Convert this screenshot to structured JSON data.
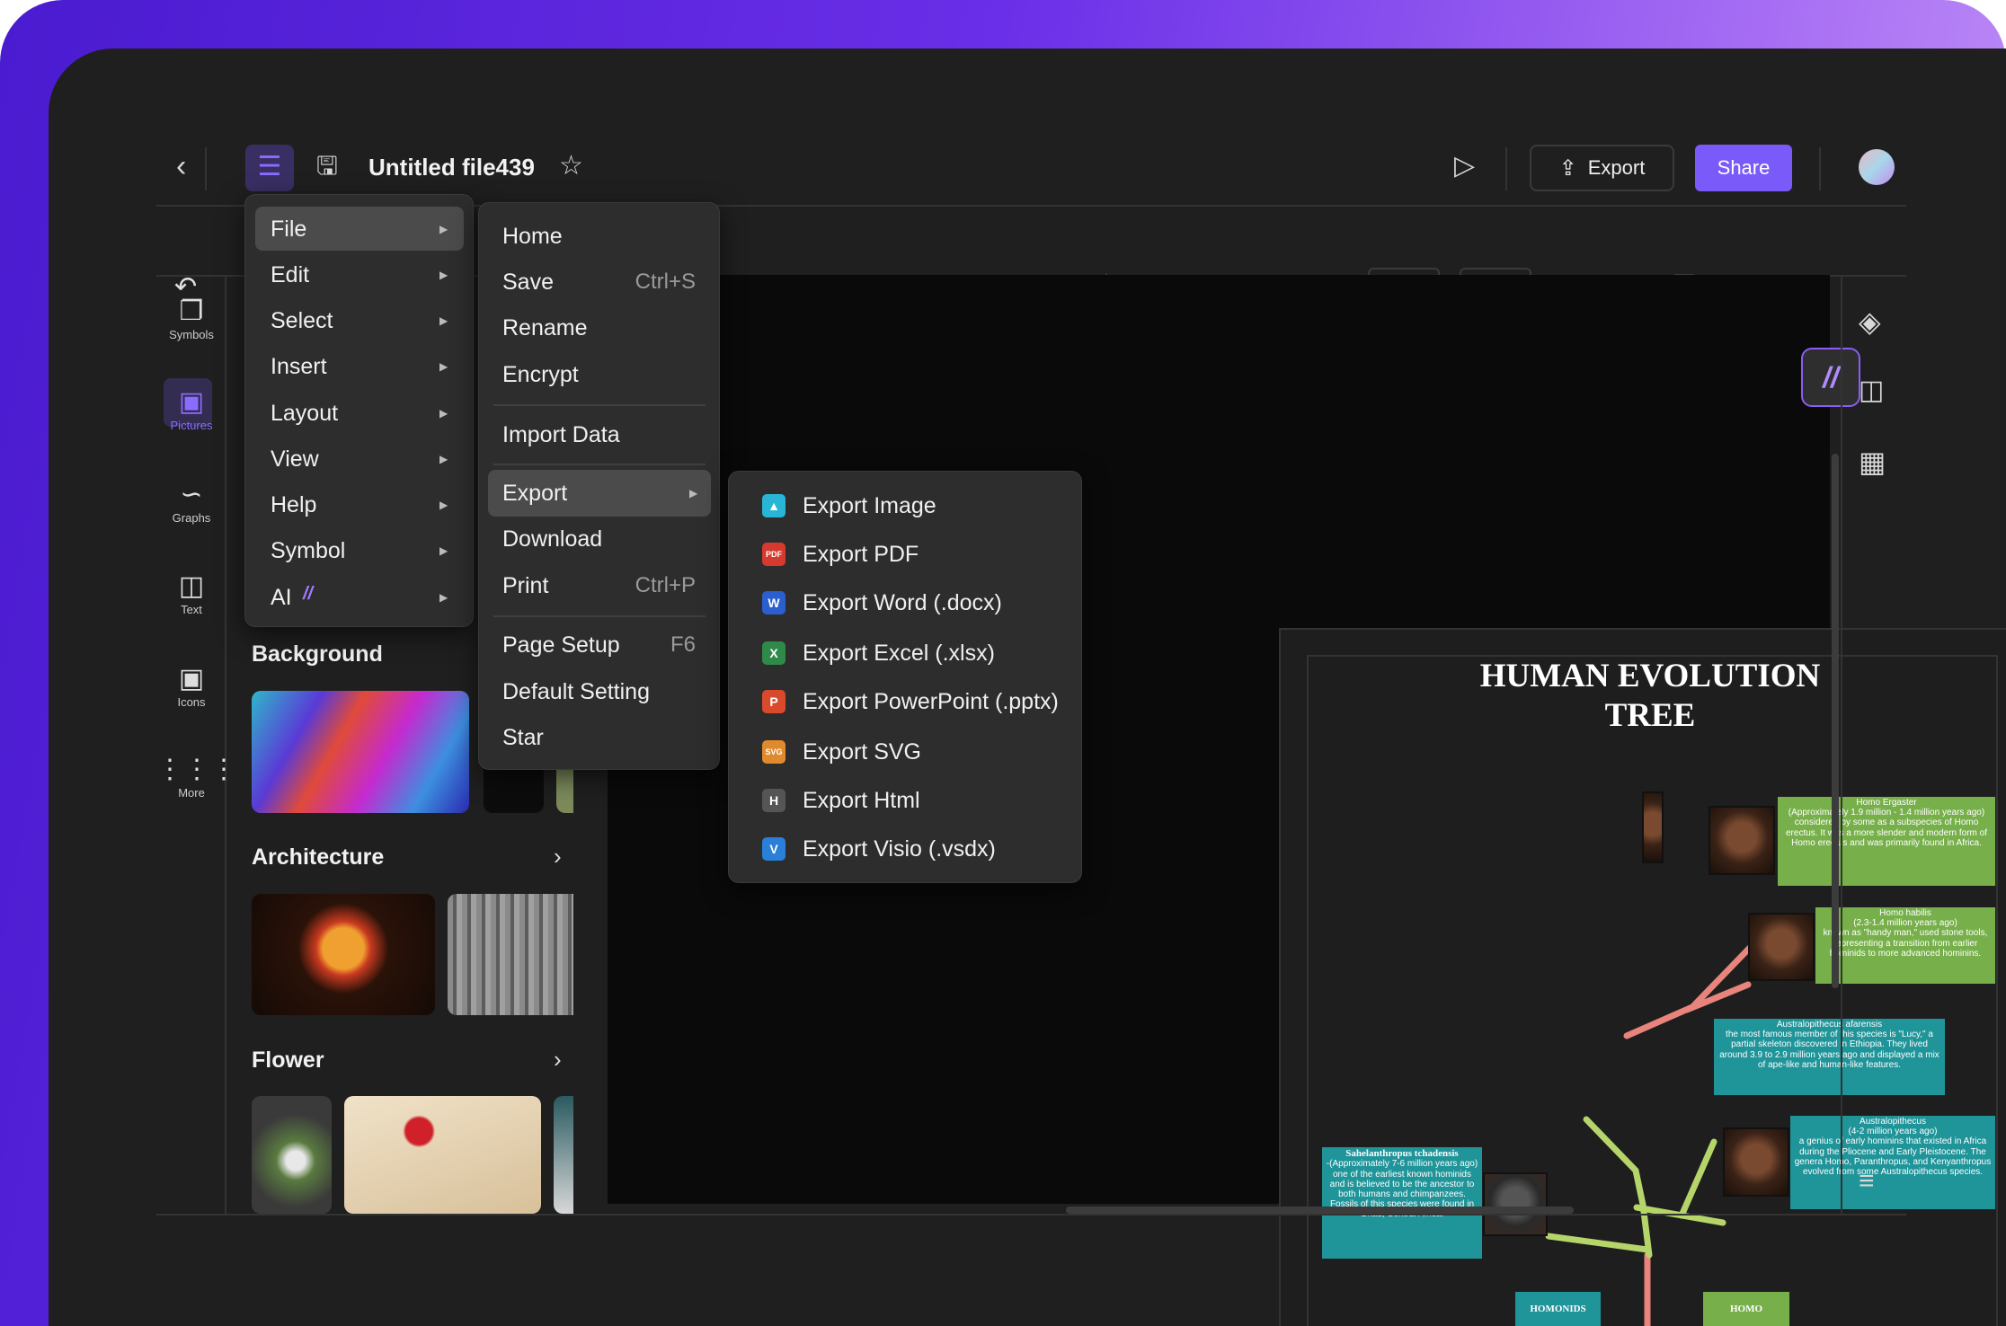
{
  "header": {
    "title": "Untitled file439",
    "export_label": "Export",
    "share_label": "Share"
  },
  "colors": {
    "accent": "#7a5af8",
    "menu_bg": "#2d2d2d",
    "canvas": "#0a0a0a",
    "green_box": "#77b04a",
    "teal_box": "#1f9499",
    "branch_red": "#e8847c",
    "branch_green": "#b5d46a"
  },
  "left_rail": {
    "items": [
      {
        "label": "Symbols",
        "icon": "symbols-icon"
      },
      {
        "label": "Pictures",
        "icon": "pictures-icon",
        "active": true
      },
      {
        "label": "Graphs",
        "icon": "graphs-icon"
      },
      {
        "label": "Text",
        "icon": "text-icon"
      },
      {
        "label": "Icons",
        "icon": "icons-icon"
      },
      {
        "label": "More",
        "icon": "more-icon"
      }
    ]
  },
  "panel": {
    "sections": [
      {
        "title": "Background"
      },
      {
        "title": "Architecture"
      },
      {
        "title": "Flower"
      }
    ]
  },
  "main_menu": {
    "items": [
      {
        "label": "File"
      },
      {
        "label": "Edit"
      },
      {
        "label": "Select"
      },
      {
        "label": "Insert"
      },
      {
        "label": "Layout"
      },
      {
        "label": "View"
      },
      {
        "label": "Help"
      },
      {
        "label": "Symbol"
      },
      {
        "label": "AI"
      }
    ],
    "selected": "File"
  },
  "file_menu": {
    "items": [
      {
        "label": "Home"
      },
      {
        "label": "Save",
        "shortcut": "Ctrl+S"
      },
      {
        "label": "Rename"
      },
      {
        "label": "Encrypt"
      },
      {
        "label": "Import Data"
      },
      {
        "label": "Export"
      },
      {
        "label": "Download"
      },
      {
        "label": "Print",
        "shortcut": "Ctrl+P"
      },
      {
        "label": "Page Setup",
        "shortcut": "F6"
      },
      {
        "label": "Default Setting"
      },
      {
        "label": "Star"
      }
    ],
    "selected": "Export"
  },
  "export_menu": {
    "items": [
      {
        "label": "Export Image",
        "badge": "",
        "color": "#29b6d6"
      },
      {
        "label": "Export PDF",
        "badge": "PDF",
        "color": "#d63a2f"
      },
      {
        "label": "Export Word (.docx)",
        "badge": "W",
        "color": "#2b5fd0"
      },
      {
        "label": "Export Excel (.xlsx)",
        "badge": "X",
        "color": "#2f8a4a"
      },
      {
        "label": "Export PowerPoint (.pptx)",
        "badge": "P",
        "color": "#d94a2c"
      },
      {
        "label": "Export SVG",
        "badge": "SVG",
        "color": "#e08a2e"
      },
      {
        "label": "Export Html",
        "badge": "H",
        "color": "#555555"
      },
      {
        "label": "Export Visio (.vsdx)",
        "badge": "V",
        "color": "#2a7fd8"
      }
    ]
  },
  "document": {
    "title_line1": "HUMAN EVOLUTION",
    "title_line2": "TREE",
    "boxes": {
      "ergaster": {
        "name": "Homo Ergaster",
        "period": "(Approximately 1.9 million - 1.4 million years ago)",
        "text": "considered by some as a subspecies of Homo erectus. It was a more slender and modern form of Homo erectus and was primarily found in Africa."
      },
      "habilis": {
        "name": "Homo habilis",
        "period": "(2.3-1.4 million years ago)",
        "text": "known as \"handy man,\" used stone tools, representing a transition from earlier hominids to more advanced hominins."
      },
      "afarensis": {
        "name": "Australopithecus afarensis",
        "text": "the most famous member of this species is \"Lucy,\" a partial skeleton discovered in Ethiopia. They lived around 3.9 to 2.9 million years ago and displayed a mix of ape-like and human-like features."
      },
      "australopithecus": {
        "name": "Australopithecus",
        "period": "(4-2 million years ago)",
        "text": "a genius of early hominins that existed in Africa during the Pliocene and Early Pleistocene. The genera Homo, Paranthropus, and Kenyanthropus evolved from some Australopithecus species."
      },
      "sahelanthropus": {
        "name": "Sahelanthropus tchadensis",
        "period": "-(Approximately 7-6 million years ago)",
        "text": "one of the earliest known hominids and is believed to be the ancestor to both humans and chimpanzees. Fossils of this species were found in Chad, Central Africa."
      },
      "homonids": {
        "name": "HOMONIDS"
      },
      "homo": {
        "name": "HOMO"
      }
    }
  }
}
